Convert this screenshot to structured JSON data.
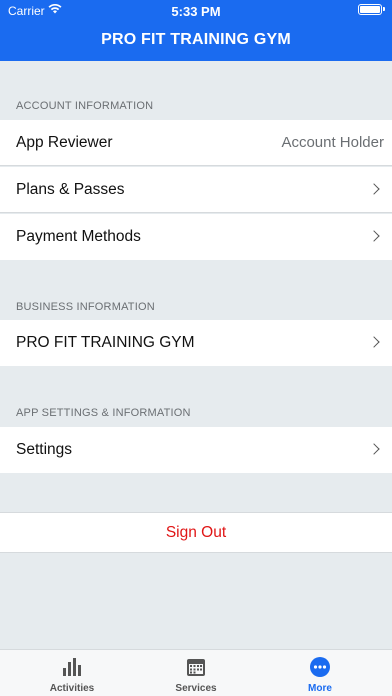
{
  "status_bar": {
    "carrier": "Carrier",
    "time": "5:33 PM"
  },
  "header": {
    "title": "PRO FIT TRAINING GYM"
  },
  "sections": [
    {
      "title": "ACCOUNT INFORMATION",
      "rows": [
        {
          "label": "App Reviewer",
          "value": "Account Holder"
        },
        {
          "label": "Plans & Passes"
        },
        {
          "label": "Payment Methods"
        }
      ]
    },
    {
      "title": "BUSINESS INFORMATION",
      "rows": [
        {
          "label": "PRO FIT TRAINING GYM"
        }
      ]
    },
    {
      "title": "APP SETTINGS & INFORMATION",
      "rows": [
        {
          "label": "Settings"
        }
      ]
    }
  ],
  "sign_out": {
    "label": "Sign Out",
    "color": "#e01515"
  },
  "tabs": [
    {
      "label": "Activities",
      "icon": "bar-chart-icon"
    },
    {
      "label": "Services",
      "icon": "calendar-icon"
    },
    {
      "label": "More",
      "icon": "more-icon",
      "active": true
    }
  ],
  "colors": {
    "accent": "#1a6bf0",
    "background": "#e6ebee"
  }
}
